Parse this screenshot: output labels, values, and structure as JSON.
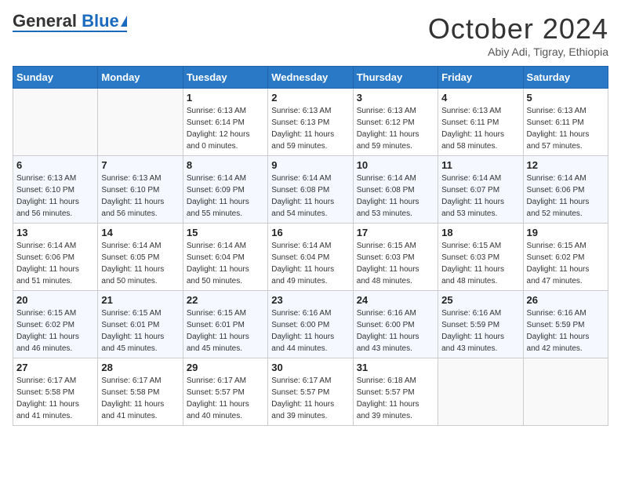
{
  "header": {
    "logo_general": "General",
    "logo_blue": "Blue",
    "month_title": "October 2024",
    "subtitle": "Abiy Adi, Tigray, Ethiopia"
  },
  "days_of_week": [
    "Sunday",
    "Monday",
    "Tuesday",
    "Wednesday",
    "Thursday",
    "Friday",
    "Saturday"
  ],
  "weeks": [
    [
      {
        "day": "",
        "info": ""
      },
      {
        "day": "",
        "info": ""
      },
      {
        "day": "1",
        "info": "Sunrise: 6:13 AM\nSunset: 6:14 PM\nDaylight: 12 hours\nand 0 minutes."
      },
      {
        "day": "2",
        "info": "Sunrise: 6:13 AM\nSunset: 6:13 PM\nDaylight: 11 hours\nand 59 minutes."
      },
      {
        "day": "3",
        "info": "Sunrise: 6:13 AM\nSunset: 6:12 PM\nDaylight: 11 hours\nand 59 minutes."
      },
      {
        "day": "4",
        "info": "Sunrise: 6:13 AM\nSunset: 6:11 PM\nDaylight: 11 hours\nand 58 minutes."
      },
      {
        "day": "5",
        "info": "Sunrise: 6:13 AM\nSunset: 6:11 PM\nDaylight: 11 hours\nand 57 minutes."
      }
    ],
    [
      {
        "day": "6",
        "info": "Sunrise: 6:13 AM\nSunset: 6:10 PM\nDaylight: 11 hours\nand 56 minutes."
      },
      {
        "day": "7",
        "info": "Sunrise: 6:13 AM\nSunset: 6:10 PM\nDaylight: 11 hours\nand 56 minutes."
      },
      {
        "day": "8",
        "info": "Sunrise: 6:14 AM\nSunset: 6:09 PM\nDaylight: 11 hours\nand 55 minutes."
      },
      {
        "day": "9",
        "info": "Sunrise: 6:14 AM\nSunset: 6:08 PM\nDaylight: 11 hours\nand 54 minutes."
      },
      {
        "day": "10",
        "info": "Sunrise: 6:14 AM\nSunset: 6:08 PM\nDaylight: 11 hours\nand 53 minutes."
      },
      {
        "day": "11",
        "info": "Sunrise: 6:14 AM\nSunset: 6:07 PM\nDaylight: 11 hours\nand 53 minutes."
      },
      {
        "day": "12",
        "info": "Sunrise: 6:14 AM\nSunset: 6:06 PM\nDaylight: 11 hours\nand 52 minutes."
      }
    ],
    [
      {
        "day": "13",
        "info": "Sunrise: 6:14 AM\nSunset: 6:06 PM\nDaylight: 11 hours\nand 51 minutes."
      },
      {
        "day": "14",
        "info": "Sunrise: 6:14 AM\nSunset: 6:05 PM\nDaylight: 11 hours\nand 50 minutes."
      },
      {
        "day": "15",
        "info": "Sunrise: 6:14 AM\nSunset: 6:04 PM\nDaylight: 11 hours\nand 50 minutes."
      },
      {
        "day": "16",
        "info": "Sunrise: 6:14 AM\nSunset: 6:04 PM\nDaylight: 11 hours\nand 49 minutes."
      },
      {
        "day": "17",
        "info": "Sunrise: 6:15 AM\nSunset: 6:03 PM\nDaylight: 11 hours\nand 48 minutes."
      },
      {
        "day": "18",
        "info": "Sunrise: 6:15 AM\nSunset: 6:03 PM\nDaylight: 11 hours\nand 48 minutes."
      },
      {
        "day": "19",
        "info": "Sunrise: 6:15 AM\nSunset: 6:02 PM\nDaylight: 11 hours\nand 47 minutes."
      }
    ],
    [
      {
        "day": "20",
        "info": "Sunrise: 6:15 AM\nSunset: 6:02 PM\nDaylight: 11 hours\nand 46 minutes."
      },
      {
        "day": "21",
        "info": "Sunrise: 6:15 AM\nSunset: 6:01 PM\nDaylight: 11 hours\nand 45 minutes."
      },
      {
        "day": "22",
        "info": "Sunrise: 6:15 AM\nSunset: 6:01 PM\nDaylight: 11 hours\nand 45 minutes."
      },
      {
        "day": "23",
        "info": "Sunrise: 6:16 AM\nSunset: 6:00 PM\nDaylight: 11 hours\nand 44 minutes."
      },
      {
        "day": "24",
        "info": "Sunrise: 6:16 AM\nSunset: 6:00 PM\nDaylight: 11 hours\nand 43 minutes."
      },
      {
        "day": "25",
        "info": "Sunrise: 6:16 AM\nSunset: 5:59 PM\nDaylight: 11 hours\nand 43 minutes."
      },
      {
        "day": "26",
        "info": "Sunrise: 6:16 AM\nSunset: 5:59 PM\nDaylight: 11 hours\nand 42 minutes."
      }
    ],
    [
      {
        "day": "27",
        "info": "Sunrise: 6:17 AM\nSunset: 5:58 PM\nDaylight: 11 hours\nand 41 minutes."
      },
      {
        "day": "28",
        "info": "Sunrise: 6:17 AM\nSunset: 5:58 PM\nDaylight: 11 hours\nand 41 minutes."
      },
      {
        "day": "29",
        "info": "Sunrise: 6:17 AM\nSunset: 5:57 PM\nDaylight: 11 hours\nand 40 minutes."
      },
      {
        "day": "30",
        "info": "Sunrise: 6:17 AM\nSunset: 5:57 PM\nDaylight: 11 hours\nand 39 minutes."
      },
      {
        "day": "31",
        "info": "Sunrise: 6:18 AM\nSunset: 5:57 PM\nDaylight: 11 hours\nand 39 minutes."
      },
      {
        "day": "",
        "info": ""
      },
      {
        "day": "",
        "info": ""
      }
    ]
  ]
}
